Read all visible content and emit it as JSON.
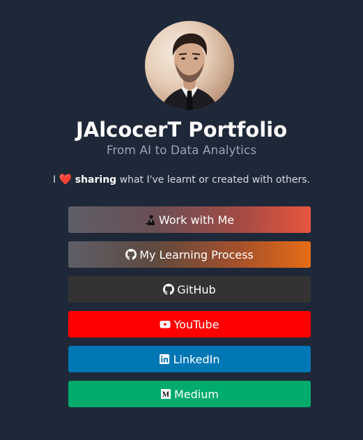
{
  "profile": {
    "name": "JAlcocerT Portfolio",
    "subtitle": "From AI to Data Analytics",
    "tagline_before": "I",
    "tagline_bold": "sharing",
    "tagline_after": "what I've learnt or created with others."
  },
  "links": [
    {
      "label": "Work with Me",
      "icon": "person-in-suit-icon",
      "color": "#e8553d"
    },
    {
      "label": "My Learning Process",
      "icon": "github-icon",
      "color": "#e56d17"
    },
    {
      "label": "GitHub",
      "icon": "github-icon",
      "color": "#333333"
    },
    {
      "label": "YouTube",
      "icon": "youtube-icon",
      "color": "#ff0000"
    },
    {
      "label": "LinkedIn",
      "icon": "linkedin-icon",
      "color": "#0077b5"
    },
    {
      "label": "Medium",
      "icon": "medium-icon",
      "color": "#00ab6c"
    }
  ],
  "theme": {
    "background": "#1f2838",
    "heart_color": "#e0313b"
  }
}
